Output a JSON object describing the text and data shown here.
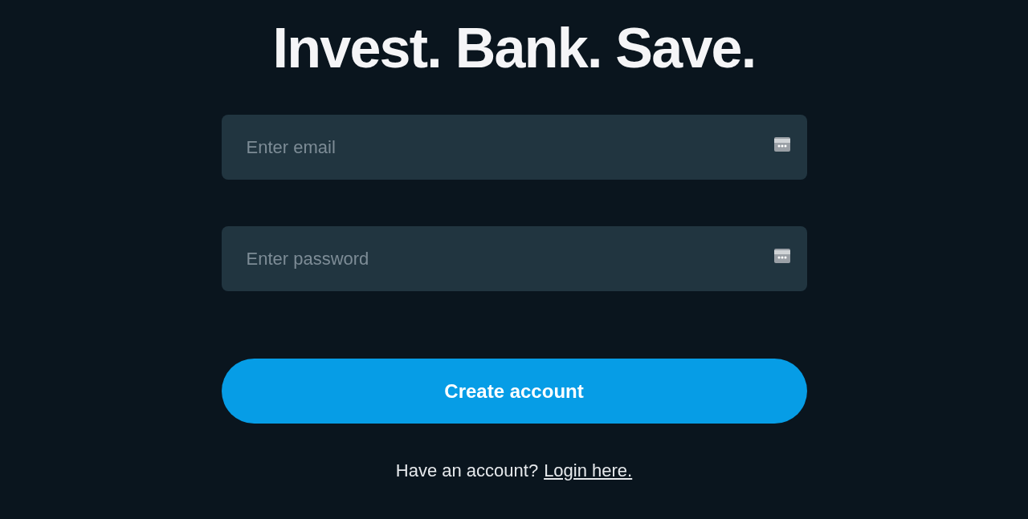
{
  "heading": "Invest. Bank. Save.",
  "fields": [
    {
      "placeholder": "Enter email"
    },
    {
      "placeholder": "Enter password"
    }
  ],
  "button": "Create account",
  "footer": {
    "text": "Have an account?",
    "link": "Login here."
  }
}
